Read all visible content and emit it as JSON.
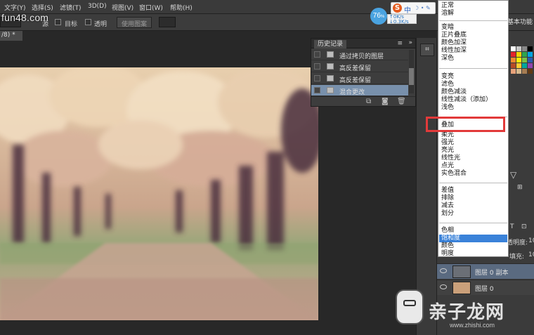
{
  "menubar": {
    "items": [
      "文字(Y)",
      "选择(S)",
      "滤镜(T)",
      "3D(D)",
      "视图(V)",
      "窗口(W)",
      "帮助(H)"
    ]
  },
  "options": {
    "flow_label": "源",
    "target_label": "目标",
    "transparent_label": "透明",
    "use_pattern_label": "使用图案"
  },
  "watermark_top": "fun48.com",
  "doc_tab": "/8) *",
  "history": {
    "title": "历史记录",
    "items": [
      {
        "label": "通过拷贝的图层",
        "active": false
      },
      {
        "label": "高反差保留",
        "active": false
      },
      {
        "label": "高反差保留",
        "active": false
      },
      {
        "label": "混合更改",
        "active": true
      }
    ]
  },
  "workspace": "基本功能",
  "system": {
    "badge": "76",
    "badge_unit": "%",
    "speed_up": "0K/s",
    "speed_down": "0.3K/s",
    "ime_cn": "中"
  },
  "blend_modes": {
    "groups": [
      [
        "正常",
        "溶解"
      ],
      [
        "变暗",
        "正片叠底",
        "颜色加深",
        "线性加深",
        "深色"
      ],
      [
        "变亮",
        "滤色",
        "颜色减淡",
        "线性减淡（添加）",
        "浅色"
      ],
      [
        "叠加",
        "柔光",
        "强光",
        "亮光",
        "线性光",
        "点光",
        "实色混合"
      ],
      [
        "差值",
        "排除",
        "减去",
        "划分"
      ],
      [
        "色相",
        "饱和度",
        "颜色",
        "明度"
      ]
    ],
    "highlighted": "饱和度",
    "boxed": "叠加"
  },
  "layers": {
    "opacity_label": "透明度:",
    "fill_label": "填充:",
    "opacity_value": "10",
    "fill_value": "10",
    "items": [
      {
        "name": "图层 0 副本",
        "selected": true
      },
      {
        "name": "图层 0",
        "selected": false
      }
    ]
  },
  "watermark_bottom": "亲子龙网",
  "watermark_sub": "www.zhishi.com",
  "colors": {
    "highlight": "#3a82d9",
    "red_box": "#e23a3a",
    "history_active": "#7890ac"
  }
}
